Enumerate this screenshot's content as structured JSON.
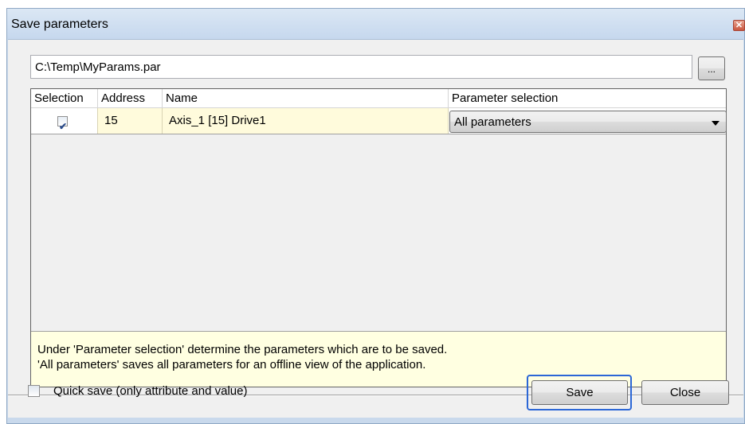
{
  "window": {
    "title": "Save parameters",
    "close_glyph": "✕"
  },
  "path": {
    "value": "C:\\Temp\\MyParams.par",
    "browse_label": "..."
  },
  "grid": {
    "headers": [
      "Selection",
      "Address",
      "Name",
      "Parameter selection"
    ],
    "rows": [
      {
        "selected": true,
        "address": "15",
        "name": "Axis_1 [15] Drive1",
        "parameter_selection": "All parameters"
      }
    ]
  },
  "info": {
    "line1": "Under 'Parameter selection' determine the parameters which are to be saved.",
    "line2": "'All parameters' saves all parameters for an offline view of the application."
  },
  "footer": {
    "quick_save_label": "Quick save (only attribute and value)",
    "quick_save_checked": false,
    "save_label": "Save",
    "close_label": "Close"
  },
  "icons": {
    "check": "check-icon",
    "dropdown": "chevron-down-icon",
    "close": "close-icon"
  },
  "colors": {
    "title_bar": "#c6d8ee",
    "info_background": "#ffffe1",
    "row_highlight": "#fffbdc",
    "focus_ring": "#2c67d6"
  }
}
